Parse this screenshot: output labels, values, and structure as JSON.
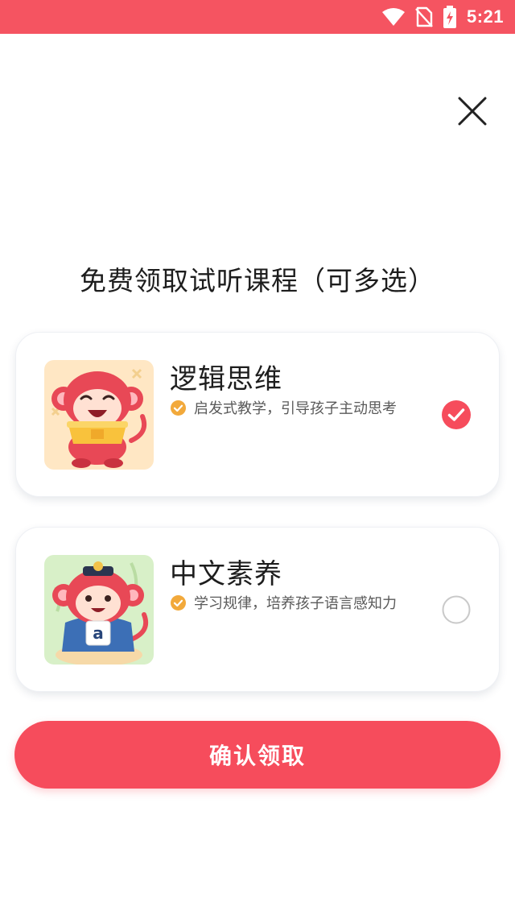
{
  "status_bar": {
    "time": "5:21",
    "background": "#f55461",
    "icons": [
      "wifi-icon",
      "no-sim-icon",
      "battery-charging-icon"
    ]
  },
  "close_icon": "close-icon",
  "title": "免费领取试听课程（可多选）",
  "courses": [
    {
      "name": "逻辑思维",
      "description": "启发式教学，引导孩子主动思考",
      "selected": true,
      "thumbnail": "logic-mascot-image"
    },
    {
      "name": "中文素养",
      "description": "学习规律，培养孩子语言感知力",
      "selected": false,
      "thumbnail": "chinese-mascot-image",
      "thumbnail_letter": "a"
    }
  ],
  "confirm_button": {
    "label": "确认领取",
    "color": "#f64c5c"
  },
  "colors": {
    "accent": "#f64c5c",
    "check_orange": "#f2a93b"
  }
}
